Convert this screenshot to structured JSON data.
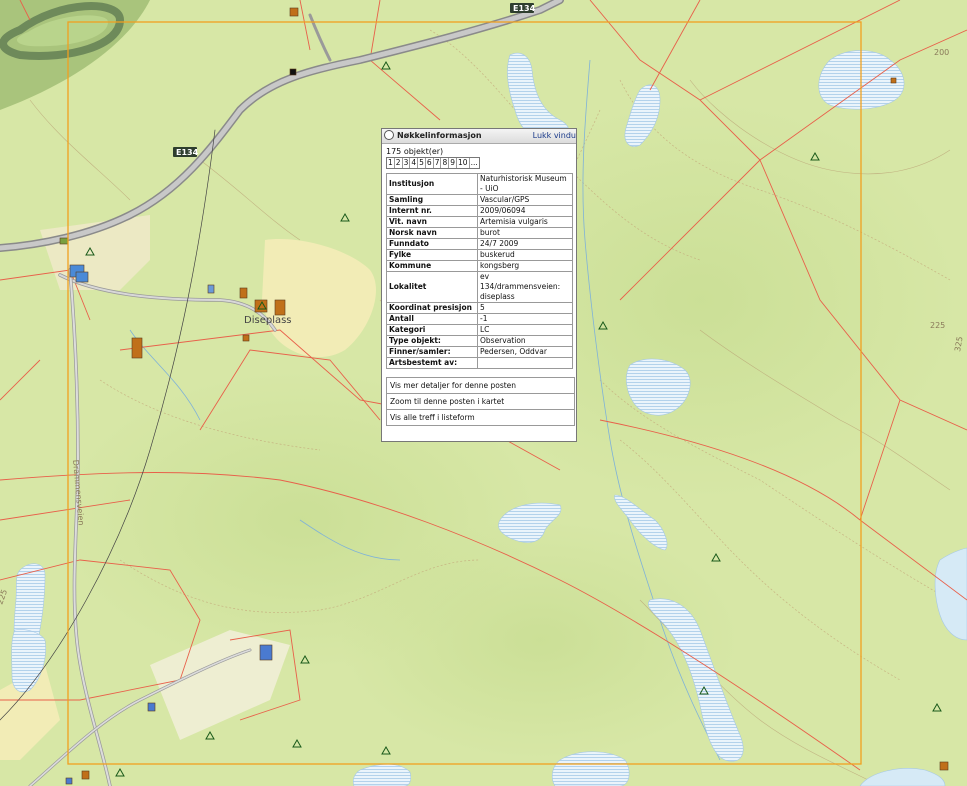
{
  "map": {
    "road_labels": [
      "E134",
      "E134"
    ],
    "place_label": "Diseplass",
    "street_label": "Drammensveien",
    "contour_labels": [
      "200",
      "225",
      "325",
      "225"
    ]
  },
  "popup": {
    "title": "Nøkkelinformasjon",
    "close_label": "Lukk vindu",
    "count_text": "175 objekt(er)",
    "pages": [
      "1",
      "2",
      "3",
      "4",
      "5",
      "6",
      "7",
      "8",
      "9",
      "10",
      "..."
    ],
    "rows": [
      {
        "key": "Institusjon",
        "value": "Naturhistorisk Museum - UiO"
      },
      {
        "key": "Samling",
        "value": "Vascular/GPS"
      },
      {
        "key": "Internt nr.",
        "value": "2009/06094"
      },
      {
        "key": "Vit. navn",
        "value": "Artemisia vulgaris"
      },
      {
        "key": "Norsk navn",
        "value": "burot"
      },
      {
        "key": "Funndato",
        "value": "24/7 2009"
      },
      {
        "key": "Fylke",
        "value": "buskerud"
      },
      {
        "key": "Kommune",
        "value": "kongsberg"
      },
      {
        "key": "Lokalitet",
        "value": "ev 134/drammensveien: diseplass"
      },
      {
        "key": "Koordinat presisjon",
        "value": "5"
      },
      {
        "key": "Antall",
        "value": "-1"
      },
      {
        "key": "Kategori",
        "value": "LC"
      },
      {
        "key": "Type objekt:",
        "value": "Observation"
      },
      {
        "key": "Finner/samler:",
        "value": "Pedersen, Oddvar"
      },
      {
        "key": "Artsbestemt av:",
        "value": ""
      }
    ],
    "links": [
      "Vis mer detaljer for denne posten",
      "Zoom til denne posten i kartet",
      "Vis alle treff i listeform"
    ]
  },
  "colors": {
    "terrain": "#d8e8a8",
    "forest_dark": "#a8c878",
    "water": "#d8ecf8",
    "boundary": "#e8604a",
    "selection": "#f0a020",
    "road": "#9a9a9a"
  }
}
